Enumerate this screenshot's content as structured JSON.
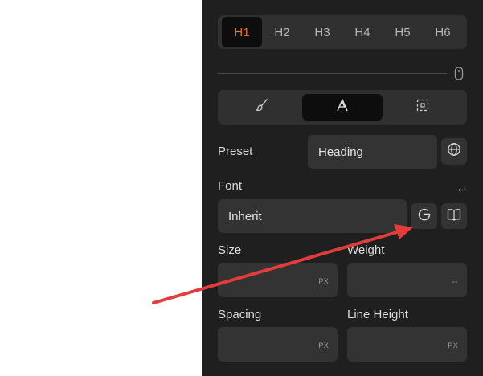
{
  "heading_tabs": [
    "H1",
    "H2",
    "H3",
    "H4",
    "H5",
    "H6"
  ],
  "active_heading": "H1",
  "accent_color": "#e0732a",
  "mode_tabs": [
    {
      "icon": "brush-icon"
    },
    {
      "icon": "typography-icon"
    },
    {
      "icon": "dashed-box-icon"
    }
  ],
  "preset": {
    "label": "Preset",
    "value": "Heading",
    "button_icon": "globe-icon"
  },
  "font": {
    "label": "Font",
    "reset_icon": "return-arrow-icon",
    "value": "Inherit",
    "buttons": [
      "google-icon",
      "book-icon"
    ]
  },
  "size": {
    "label": "Size",
    "unit": "PX"
  },
  "weight": {
    "label": "Weight",
    "value": "--"
  },
  "spacing": {
    "label": "Spacing",
    "unit": "PX"
  },
  "line_height": {
    "label": "Line Height",
    "unit": "PX"
  },
  "annotation": {
    "color": "#e23c3c",
    "points_to": "google-fonts-button"
  }
}
